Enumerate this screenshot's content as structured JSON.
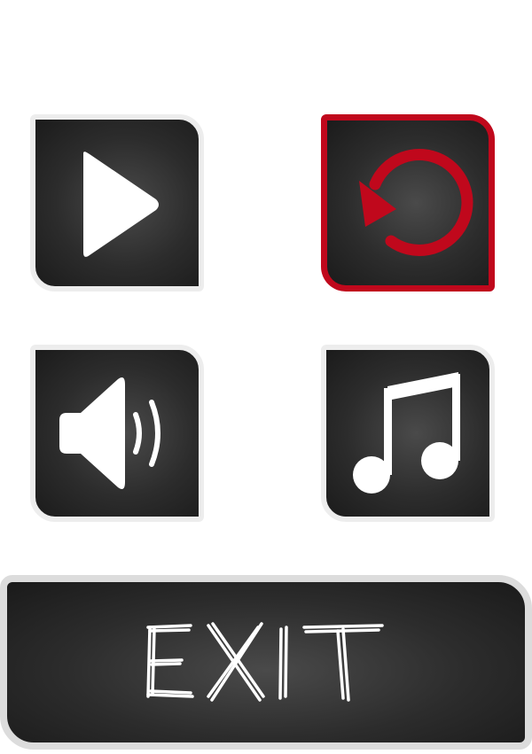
{
  "menu": {
    "buttons": [
      {
        "id": "play",
        "icon": "play-icon",
        "selected": false
      },
      {
        "id": "restart",
        "icon": "restart-icon",
        "selected": true
      },
      {
        "id": "sound",
        "icon": "speaker-icon",
        "selected": false
      },
      {
        "id": "music",
        "icon": "music-note-icon",
        "selected": false
      }
    ],
    "exit": {
      "label": "EXIT"
    }
  },
  "colors": {
    "tile_bg": "#2c2c2c",
    "tile_border": "#ededed",
    "selected_accent": "#c0081c",
    "icon_white": "#ffffff",
    "exit_border": "#dcdcdc"
  }
}
